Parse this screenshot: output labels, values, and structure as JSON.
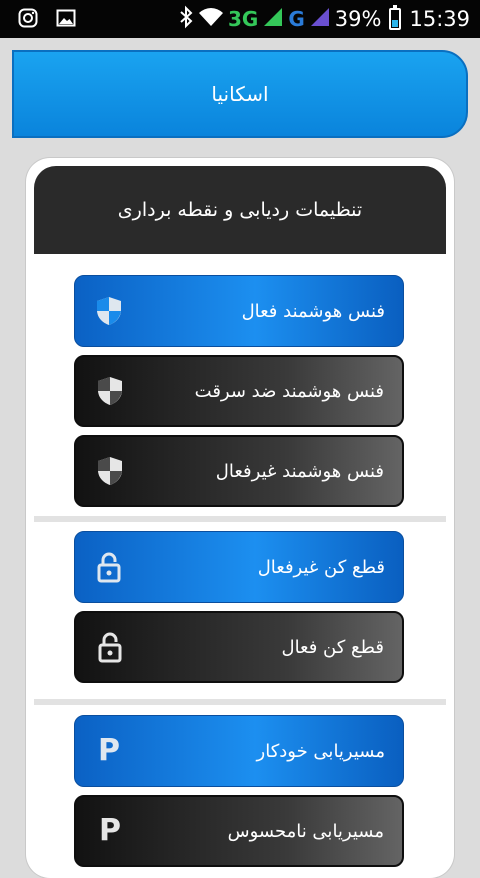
{
  "status_bar": {
    "network": "3G",
    "carrier_g": "G",
    "battery": "39%",
    "time": "15:39",
    "icons": [
      "instagram-icon",
      "gallery-icon",
      "bluetooth-icon",
      "wifi-icon",
      "signal-icon",
      "battery-icon"
    ]
  },
  "appbar": {
    "title": "اسکانیا"
  },
  "panel": {
    "title": "تنظیمات ردیابی و نقطه برداری",
    "groups": [
      {
        "buttons": [
          {
            "label": "فنس هوشمند فعال",
            "icon": "shield-icon",
            "style": "blue"
          },
          {
            "label": "فنس هوشمند ضد سرقت",
            "icon": "shield-icon",
            "style": "dark"
          },
          {
            "label": "فنس هوشمند غیرفعال",
            "icon": "shield-icon",
            "style": "dark"
          }
        ]
      },
      {
        "buttons": [
          {
            "label": "قطع کن غیرفعال",
            "icon": "unlock-icon",
            "style": "blue"
          },
          {
            "label": "قطع کن فعال",
            "icon": "unlock-icon",
            "style": "dark"
          }
        ]
      },
      {
        "buttons": [
          {
            "label": "مسیریابی خودکار",
            "icon": "parking-icon",
            "icon_text": "P",
            "style": "blue"
          },
          {
            "label": "مسیریابی نامحسوس",
            "icon": "parking-icon",
            "icon_text": "P",
            "style": "dark"
          }
        ]
      }
    ]
  },
  "colors": {
    "blue_accent": "#1c8ff0",
    "dark_button": "#2a2a2a",
    "icon_light": "#dfe7ef",
    "icon_blue": "#1a8bea"
  }
}
